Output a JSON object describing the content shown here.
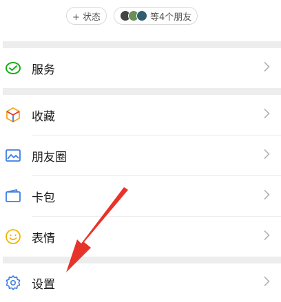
{
  "status_bar": {
    "add_status_label": "+ 状态",
    "friends_label": "等4个朋友"
  },
  "menu": {
    "services": "服务",
    "favorites": "收藏",
    "moments": "朋友圈",
    "cards": "卡包",
    "stickers": "表情",
    "settings": "设置"
  },
  "icons": {
    "services": "wechat-pay-icon",
    "favorites": "cube-icon",
    "moments": "picture-icon",
    "cards": "wallet-icon",
    "stickers": "smiley-icon",
    "settings": "gear-icon",
    "chevron": "chevron-right-icon"
  },
  "colors": {
    "services": "#1aad19",
    "favorites": "#f5a623",
    "moments": "#3d7de2",
    "cards": "#3d7de2",
    "stickers": "#f5b400",
    "settings": "#3d7de2",
    "annotation_arrow": "#e8332a"
  }
}
